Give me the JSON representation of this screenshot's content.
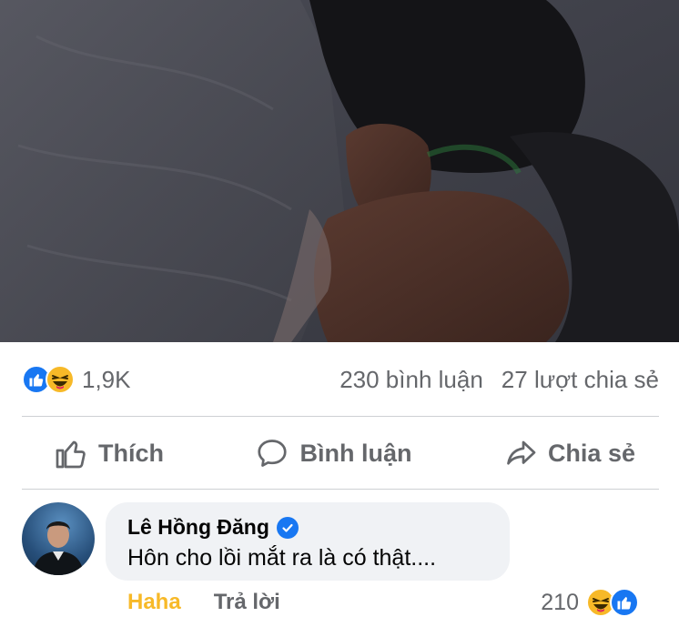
{
  "post": {
    "image_alt": "post photo"
  },
  "summary": {
    "reaction_count": "1,9K",
    "comments": "230 bình luận",
    "shares": "27 lượt chia sẻ",
    "reaction_icons": [
      "like-icon",
      "haha-icon"
    ]
  },
  "actions": {
    "like_label": "Thích",
    "comment_label": "Bình luận",
    "share_label": "Chia sẻ"
  },
  "comment": {
    "author": "Lê Hồng Đăng",
    "verified": true,
    "text": "Hôn cho lồi mắt ra là có thật....",
    "reaction_label": "Haha",
    "reply_label": "Trả lời",
    "reaction_count": "210"
  },
  "colors": {
    "facebook_blue": "#1877f2",
    "haha_yellow": "#f7b928",
    "secondary_text": "#65676b",
    "bubble_bg": "#f0f2f5"
  }
}
